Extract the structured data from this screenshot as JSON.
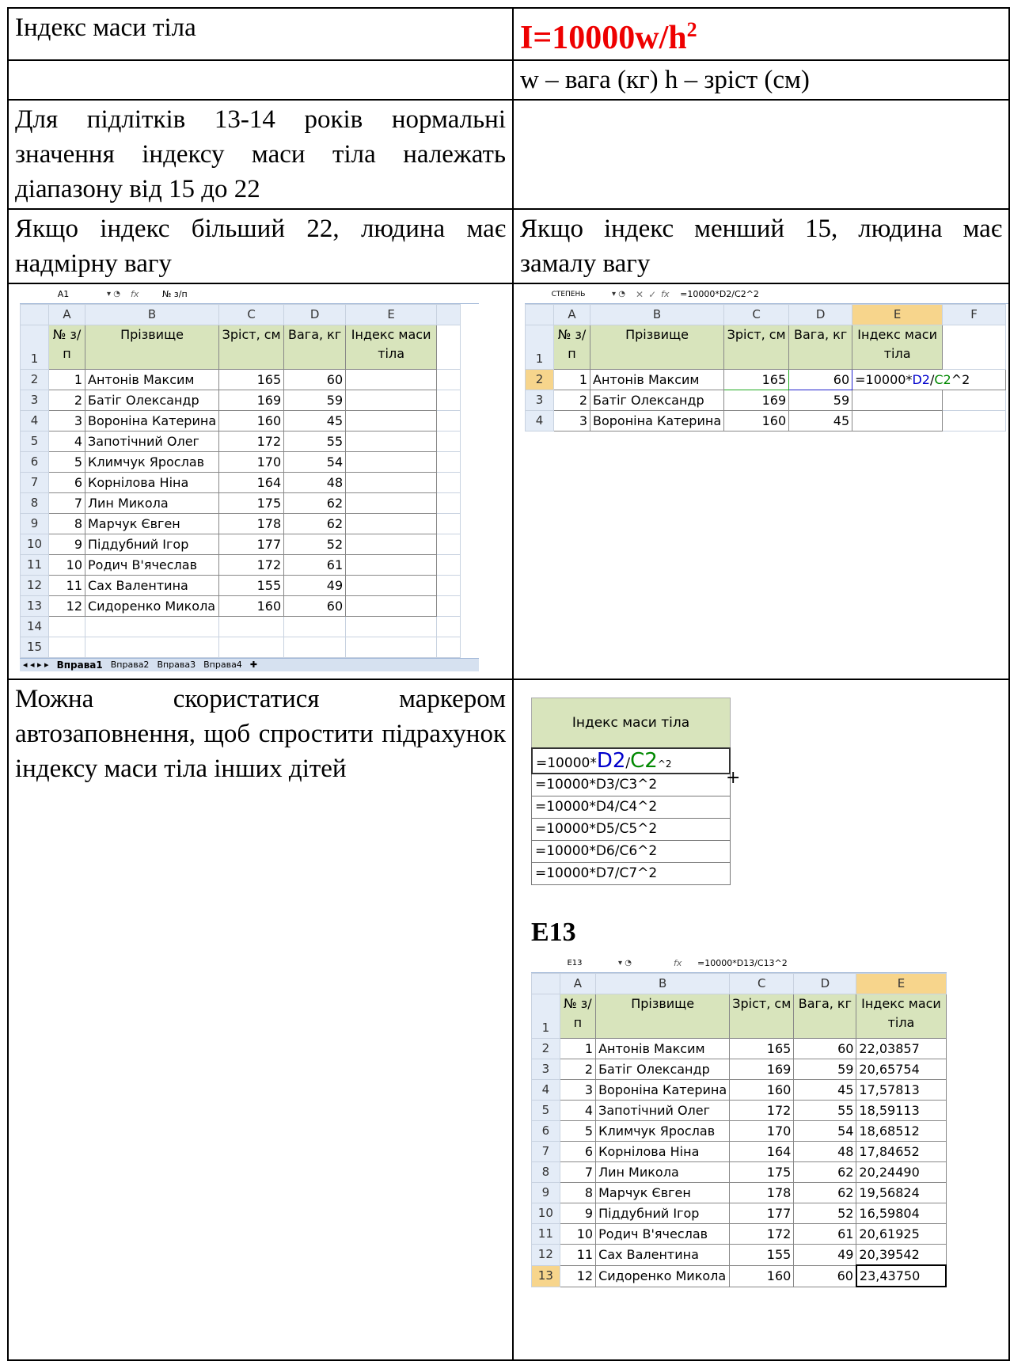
{
  "row1": {
    "left": "Індекс маси тіла",
    "formula_main": "I=10000w/h",
    "formula_sup": "2"
  },
  "row2": {
    "right": "w – вага (кг) h – зріст (см)"
  },
  "row3": {
    "left": "Для підлітків 13-14 років нормальні значення індексу маси тіла належать діапазону від 15 до 22"
  },
  "row4": {
    "left": "Якщо індекс більший 22, людина має надмірну вагу",
    "right": "Якщо індекс менший 15, людина має замалу вагу"
  },
  "row6": {
    "left": "Можна скористатися маркером автозаповнення, щоб спростити підрахунок індексу маси тіла інших дітей",
    "label_e13": "E13"
  },
  "sheet1": {
    "cellref": "A1",
    "formula": "№ з/п",
    "cols": [
      "A",
      "B",
      "C",
      "D",
      "E"
    ],
    "head": {
      "n": "№ з/п",
      "name": "Прізвище",
      "h": "Зріст, см",
      "w": "Вага, кг",
      "i": "Індекс маси тіла"
    },
    "rows": [
      {
        "r": "2",
        "n": "1",
        "name": "Антонів Максим",
        "h": "165",
        "w": "60"
      },
      {
        "r": "3",
        "n": "2",
        "name": "Батіг Олександр",
        "h": "169",
        "w": "59"
      },
      {
        "r": "4",
        "n": "3",
        "name": "Вороніна Катерина",
        "h": "160",
        "w": "45"
      },
      {
        "r": "5",
        "n": "4",
        "name": "Запотічний Олег",
        "h": "172",
        "w": "55"
      },
      {
        "r": "6",
        "n": "5",
        "name": "Климчук Ярослав",
        "h": "170",
        "w": "54"
      },
      {
        "r": "7",
        "n": "6",
        "name": "Корнілова Ніна",
        "h": "164",
        "w": "48"
      },
      {
        "r": "8",
        "n": "7",
        "name": "Лин Микола",
        "h": "175",
        "w": "62"
      },
      {
        "r": "9",
        "n": "8",
        "name": "Марчук Євген",
        "h": "178",
        "w": "62"
      },
      {
        "r": "10",
        "n": "9",
        "name": "Піддубний Ігор",
        "h": "177",
        "w": "52"
      },
      {
        "r": "11",
        "n": "10",
        "name": "Родич В'ячеслав",
        "h": "172",
        "w": "61"
      },
      {
        "r": "12",
        "n": "11",
        "name": "Сах Валентина",
        "h": "155",
        "w": "49"
      },
      {
        "r": "13",
        "n": "12",
        "name": "Сидоренко Микола",
        "h": "160",
        "w": "60"
      }
    ],
    "extra_rows": [
      "14",
      "15"
    ],
    "tabs": [
      "Вправа1",
      "Вправа2",
      "Вправа3",
      "Вправа4"
    ]
  },
  "sheet2": {
    "cellref": "СТЕПЕНЬ",
    "formula": "=10000*D2/C2^2",
    "cols": [
      "A",
      "B",
      "C",
      "D",
      "E",
      "F"
    ],
    "rows": [
      {
        "r": "2",
        "n": "1",
        "name": "Антонів Максим",
        "h": "165",
        "w": "60"
      },
      {
        "r": "3",
        "n": "2",
        "name": "Батіг Олександр",
        "h": "169",
        "w": "59"
      },
      {
        "r": "4",
        "n": "3",
        "name": "Вороніна Катерина",
        "h": "160",
        "w": "45"
      }
    ],
    "edit": {
      "a": "=10000*",
      "b": "D2",
      "c": "/",
      "d": "C2",
      "e": "^2"
    }
  },
  "fill": {
    "header": "Індекс маси тіла",
    "first": {
      "a": "=10000*",
      "b": "D2",
      "c": "/",
      "d": "C2",
      "e": "^2"
    },
    "rest": [
      "=10000*D3/C3^2",
      "=10000*D4/C4^2",
      "=10000*D5/C5^2",
      "=10000*D6/C6^2",
      "=10000*D7/C7^2"
    ]
  },
  "sheet3": {
    "cellref": "E13",
    "formula": "=10000*D13/C13^2",
    "cols": [
      "A",
      "B",
      "C",
      "D",
      "E"
    ],
    "rows": [
      {
        "r": "2",
        "n": "1",
        "name": "Антонів Максим",
        "h": "165",
        "w": "60",
        "i": "22,03857"
      },
      {
        "r": "3",
        "n": "2",
        "name": "Батіг Олександр",
        "h": "169",
        "w": "59",
        "i": "20,65754"
      },
      {
        "r": "4",
        "n": "3",
        "name": "Вороніна Катерина",
        "h": "160",
        "w": "45",
        "i": "17,57813"
      },
      {
        "r": "5",
        "n": "4",
        "name": "Запотічний Олег",
        "h": "172",
        "w": "55",
        "i": "18,59113"
      },
      {
        "r": "6",
        "n": "5",
        "name": "Климчук Ярослав",
        "h": "170",
        "w": "54",
        "i": "18,68512"
      },
      {
        "r": "7",
        "n": "6",
        "name": "Корнілова Ніна",
        "h": "164",
        "w": "48",
        "i": "17,84652"
      },
      {
        "r": "8",
        "n": "7",
        "name": "Лин Микола",
        "h": "175",
        "w": "62",
        "i": "20,24490"
      },
      {
        "r": "9",
        "n": "8",
        "name": "Марчук Євген",
        "h": "178",
        "w": "62",
        "i": "19,56824"
      },
      {
        "r": "10",
        "n": "9",
        "name": "Піддубний Ігор",
        "h": "177",
        "w": "52",
        "i": "16,59804"
      },
      {
        "r": "11",
        "n": "10",
        "name": "Родич В'ячеслав",
        "h": "172",
        "w": "61",
        "i": "20,61925"
      },
      {
        "r": "12",
        "n": "11",
        "name": "Сах Валентина",
        "h": "155",
        "w": "49",
        "i": "20,39542"
      },
      {
        "r": "13",
        "n": "12",
        "name": "Сидоренко Микола",
        "h": "160",
        "w": "60",
        "i": "23,43750"
      }
    ]
  }
}
